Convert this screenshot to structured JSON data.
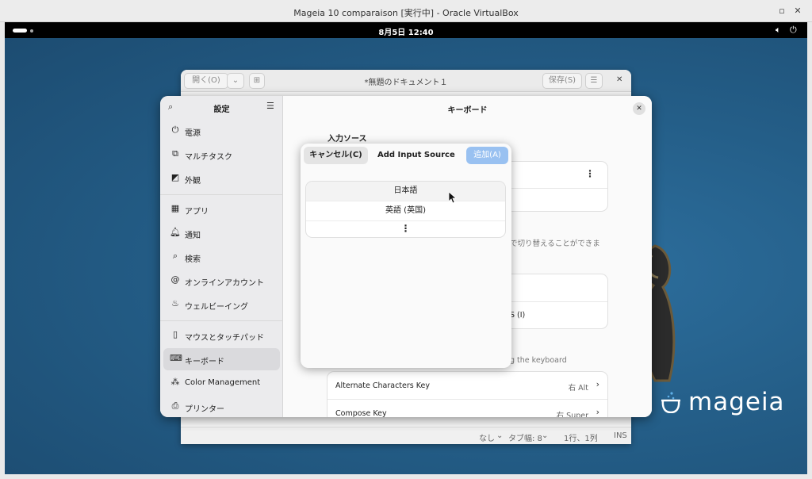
{
  "host": {
    "title": "Mageia 10 comparaison [実行中] - Oracle VirtualBox",
    "restore_icon": "restore-icon",
    "close_icon": "close-icon"
  },
  "topbar": {
    "clock": "8月5日  12:40",
    "volume_icon": "volume-icon",
    "power_icon": "power-icon"
  },
  "editor": {
    "open_label": "開く(O)",
    "title": "*無題のドキュメント１",
    "save_label": "保存(S)",
    "status": {
      "syntax": "なし",
      "tab_width": "タブ幅: 8",
      "position": "1行、1列",
      "mode": "INS"
    }
  },
  "settings": {
    "sidebar_title": "設定",
    "items": [
      {
        "icon": "power-icon",
        "label": "電源"
      },
      {
        "icon": "multitask-icon",
        "label": "マルチタスク"
      },
      {
        "icon": "appearance-icon",
        "label": "外観"
      },
      {
        "icon": "apps-icon",
        "label": "アプリ"
      },
      {
        "icon": "bell-icon",
        "label": "通知"
      },
      {
        "icon": "search-icon",
        "label": "検索"
      },
      {
        "icon": "at-icon",
        "label": "オンラインアカウント"
      },
      {
        "icon": "wellbeing-icon",
        "label": "ウェルビーイング"
      },
      {
        "icon": "mouse-icon",
        "label": "マウスとタッチパッド"
      },
      {
        "icon": "keyboard-icon",
        "label": "キーボード"
      },
      {
        "icon": "color-icon",
        "label": "Color Management"
      },
      {
        "icon": "printer-icon",
        "label": "プリンター"
      }
    ],
    "active_item": "キーボード",
    "content_title": "キーボード",
    "input_sources_label": "入力ソース",
    "switch_desc_fragment": "で切り替えることができま",
    "shortcut_fragment": "S (I)",
    "keyboard_desc_fragment": "g the keyboard",
    "rows": [
      {
        "label": "Alternate Characters Key",
        "value": "右 Alt"
      },
      {
        "label": "Compose Key",
        "value": "右 Super"
      }
    ]
  },
  "dialog": {
    "cancel_label": "キャンセル(C)",
    "title": "Add Input Source",
    "add_label": "追加(A)",
    "options": [
      "日本語",
      "英語 (英国)"
    ],
    "more_icon": "more-icon"
  },
  "logo": {
    "text": "mageia"
  }
}
